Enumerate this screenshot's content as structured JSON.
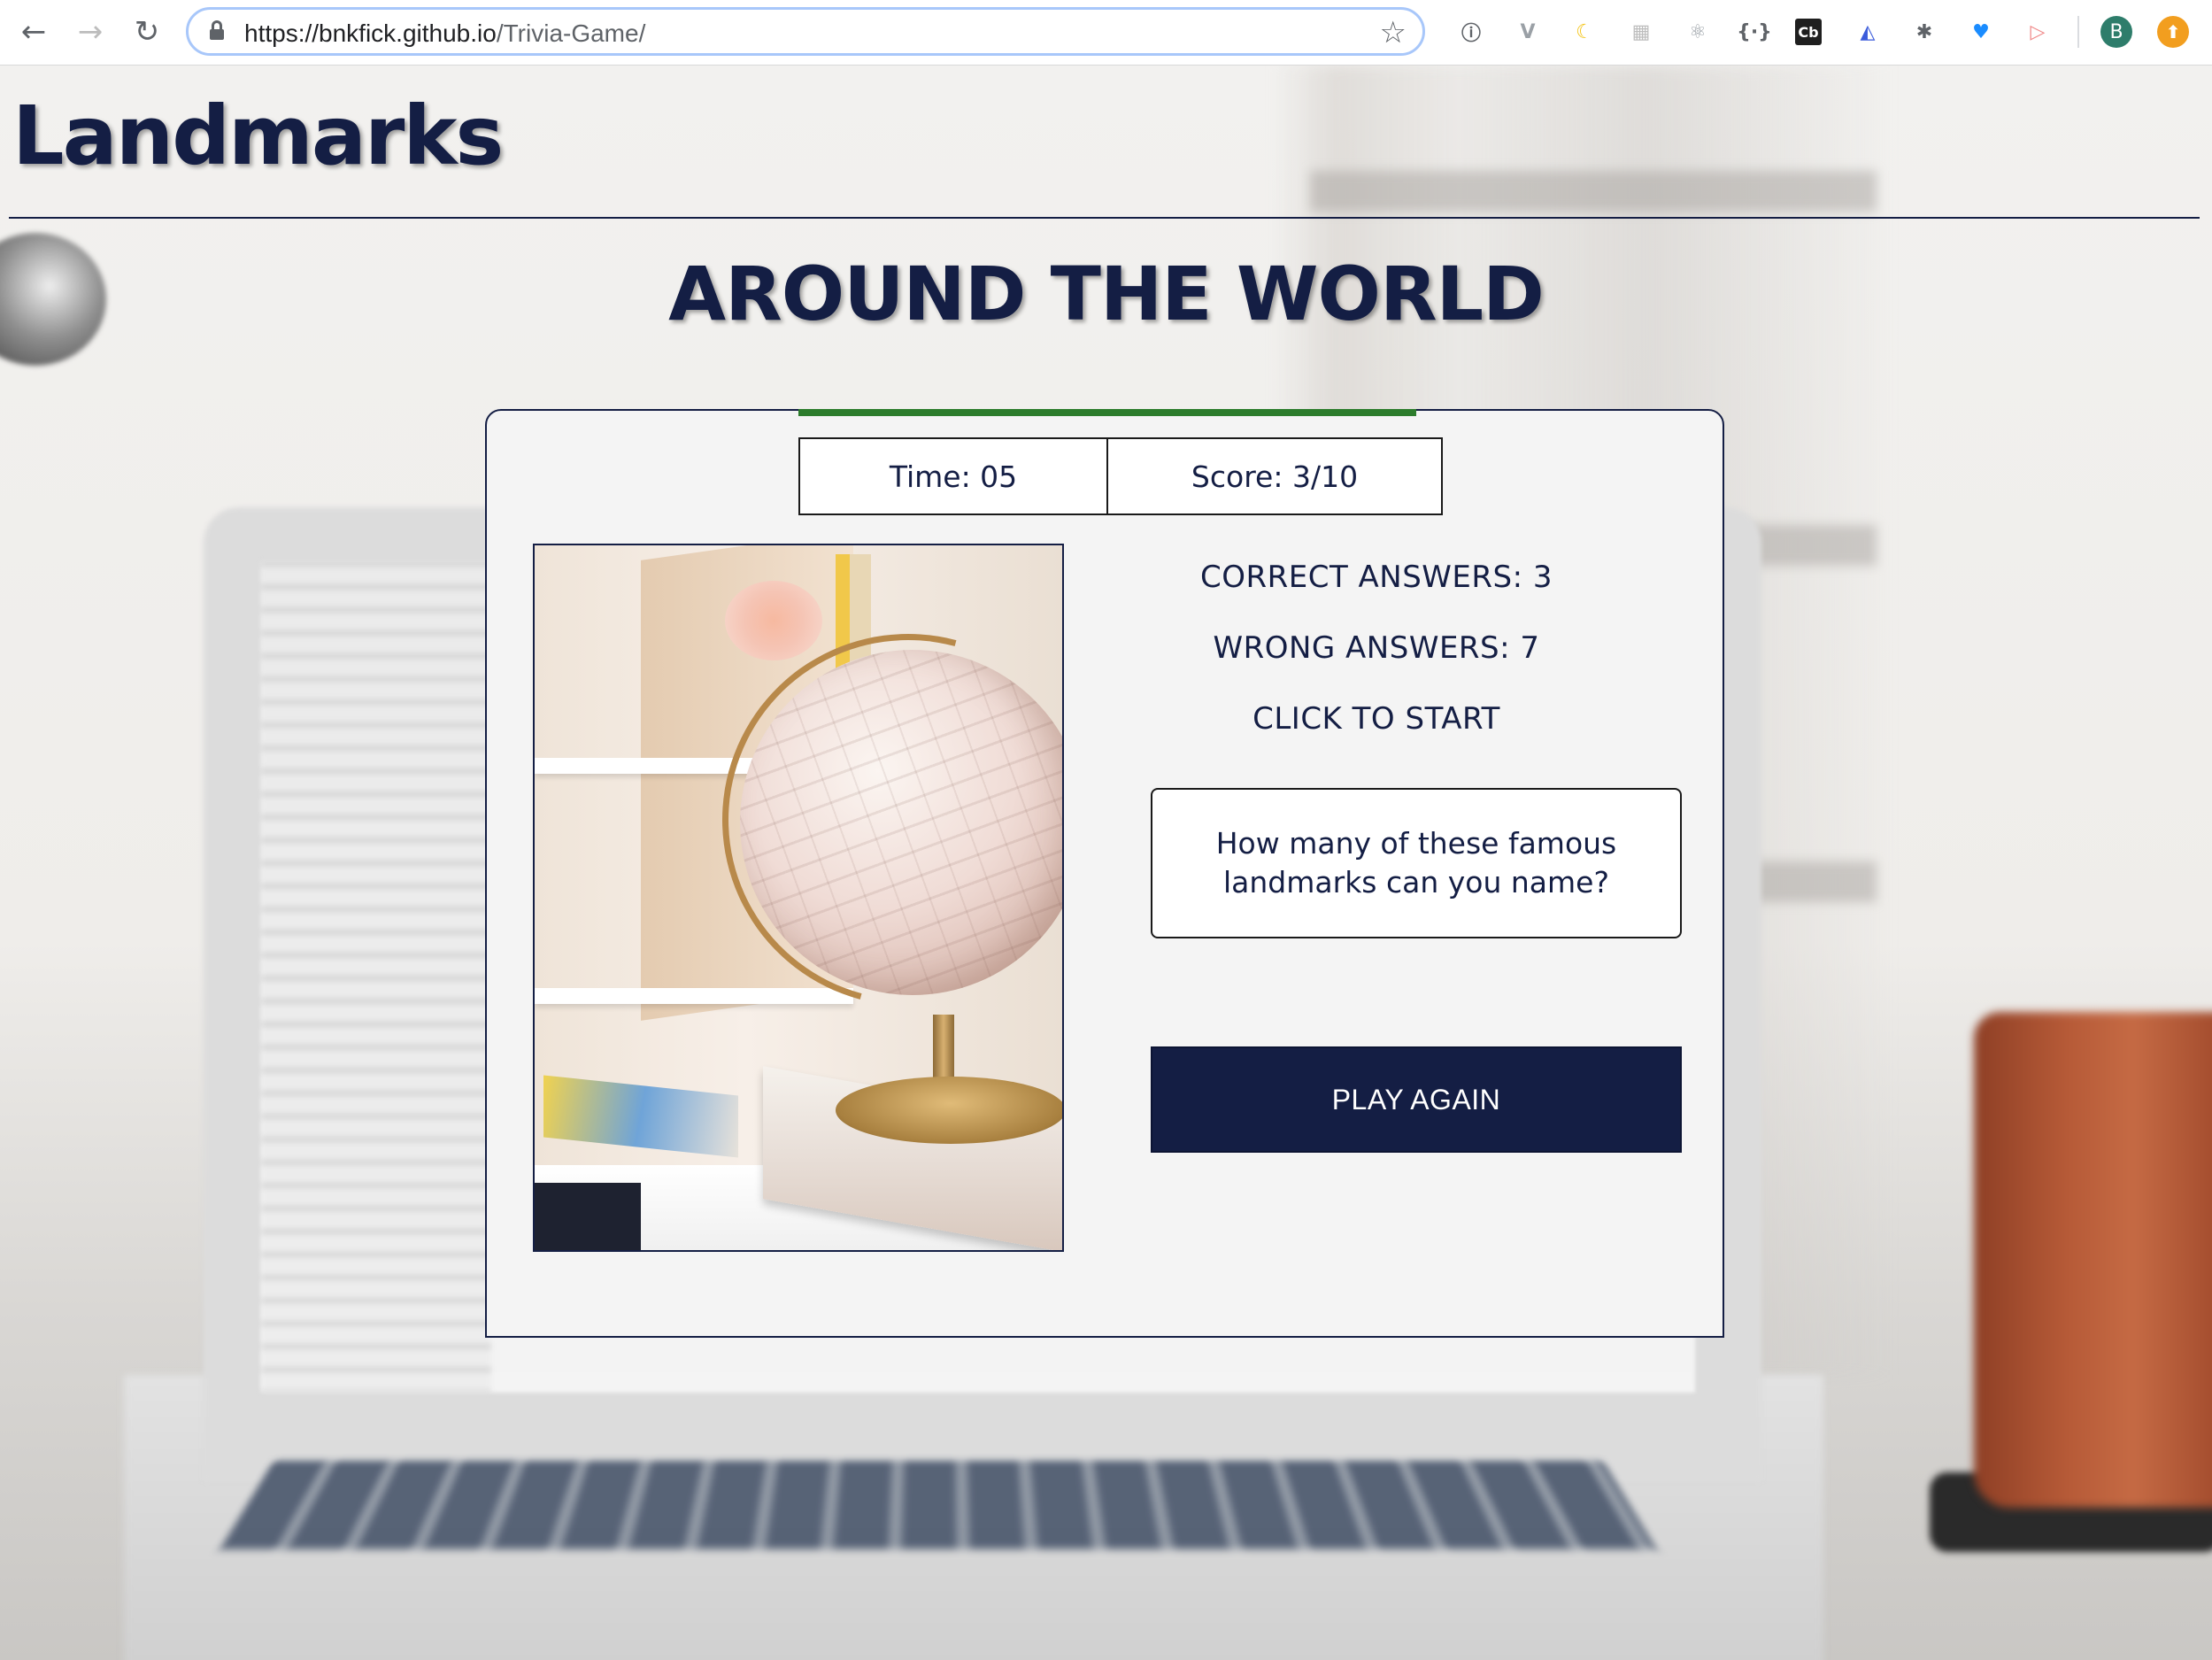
{
  "browser": {
    "url_host": "https://bnkfick.github.io",
    "url_path": "/Trivia-Game/",
    "profile_initial": "B",
    "extensions": [
      {
        "name": "1password-icon",
        "glyph": "ⓘ",
        "color": "#5f6368"
      },
      {
        "name": "vue-devtools-icon",
        "glyph": "V",
        "color": "#9aa0a6"
      },
      {
        "name": "dark-mode-icon",
        "glyph": "☾",
        "color": "#f4c20d"
      },
      {
        "name": "extension-icon",
        "glyph": "▦",
        "color": "#bdbdbd"
      },
      {
        "name": "react-devtools-icon",
        "glyph": "⚛",
        "color": "#9aa0a6"
      },
      {
        "name": "json-viewer-icon",
        "glyph": "{·}",
        "color": "#5f6368"
      },
      {
        "name": "cb-icon",
        "glyph": "Cb",
        "color": "#ffffff"
      },
      {
        "name": "analytics-icon",
        "glyph": "◭",
        "color": "#3b5bdb"
      },
      {
        "name": "bug-icon",
        "glyph": "✱",
        "color": "#5f6368"
      },
      {
        "name": "vpn-shield-icon",
        "glyph": "♥",
        "color": "#1a8cff"
      },
      {
        "name": "cast-icon",
        "glyph": "▷",
        "color": "#f08a8a"
      }
    ]
  },
  "header": {
    "site_title": "Landmarks",
    "subtitle": "AROUND THE WORLD"
  },
  "game": {
    "progress_fraction": 1.0,
    "time_label": "Time: 05",
    "score_label": "Score: 3/10",
    "correct_answers": "CORRECT ANSWERS: 3",
    "wrong_answers": "WRONG ANSWERS: 7",
    "start_prompt": "CLICK TO START",
    "question": "How many of these famous landmarks can you name?",
    "play_again_label": "PLAY AGAIN"
  },
  "colors": {
    "brand_navy": "#141e44",
    "progress_green": "#2c7c2c"
  }
}
